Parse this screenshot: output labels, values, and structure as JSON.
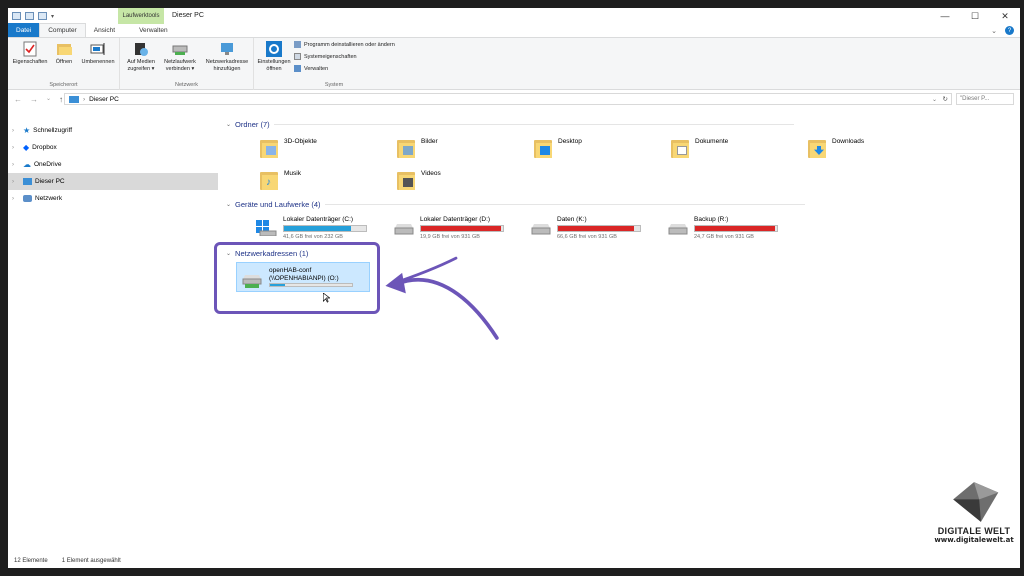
{
  "window": {
    "title": "Dieser PC",
    "context_tab": "Laufwerktools"
  },
  "tabs": [
    {
      "label": "Datei"
    },
    {
      "label": "Computer"
    },
    {
      "label": "Ansicht"
    },
    {
      "label": "Verwalten"
    }
  ],
  "ribbon": {
    "groups": [
      {
        "name": "Speicherort",
        "buttons": [
          "Eigenschaften",
          "Öffnen",
          "Umbenennen"
        ]
      },
      {
        "name": "Netzwerk",
        "buttons": [
          "Auf Medien zugreifen ▾",
          "Netzlaufwerk verbinden ▾",
          "Netzwerkadresse hinzufügen"
        ]
      },
      {
        "name": "System",
        "big_button": "Einstellungen öffnen",
        "small": [
          "Programm deinstallieren oder ändern",
          "Systemeigenschaften",
          "Verwalten"
        ]
      }
    ]
  },
  "address": {
    "path": "Dieser PC",
    "search_placeholder": "\"Dieser P..."
  },
  "sidebar": {
    "items": [
      {
        "label": "Schnellzugriff",
        "icon": "star-icon"
      },
      {
        "label": "Dropbox",
        "icon": "dropbox-icon"
      },
      {
        "label": "OneDrive",
        "icon": "cloud-icon"
      },
      {
        "label": "Dieser PC",
        "icon": "pc-icon",
        "selected": true
      },
      {
        "label": "Netzwerk",
        "icon": "network-icon"
      }
    ]
  },
  "sections": {
    "folders": "Ordner (7)",
    "drives": "Geräte und Laufwerke (4)",
    "network": "Netzwerkadressen (1)"
  },
  "folders": [
    "3D-Objekte",
    "Bilder",
    "Desktop",
    "Dokumente",
    "Downloads",
    "Musik",
    "Videos"
  ],
  "drives": [
    {
      "name": "Lokaler Datenträger (C:)",
      "free": "41,6 GB frei von 232 GB",
      "used_fraction": 0.82,
      "color": "#26a0da"
    },
    {
      "name": "Lokaler Datenträger (D:)",
      "free": "19,9 GB frei von 931 GB",
      "used_fraction": 0.98,
      "color": "#da2626"
    },
    {
      "name": "Daten (K:)",
      "free": "66,6 GB frei von 931 GB",
      "used_fraction": 0.93,
      "color": "#da2626"
    },
    {
      "name": "Backup (R:)",
      "free": "24,7 GB frei von 931 GB",
      "used_fraction": 0.97,
      "color": "#da2626"
    }
  ],
  "network_drive": {
    "line1": "openHAB-conf",
    "line2": "(\\\\OPENHABIANPI) (O:)",
    "used_fraction": 0.18,
    "color": "#26a0da"
  },
  "status": {
    "count": "12 Elemente",
    "selected": "1 Element ausgewählt"
  },
  "brand": {
    "name": "DIGITALE WELT",
    "url": "www.digitalewelt.at"
  }
}
